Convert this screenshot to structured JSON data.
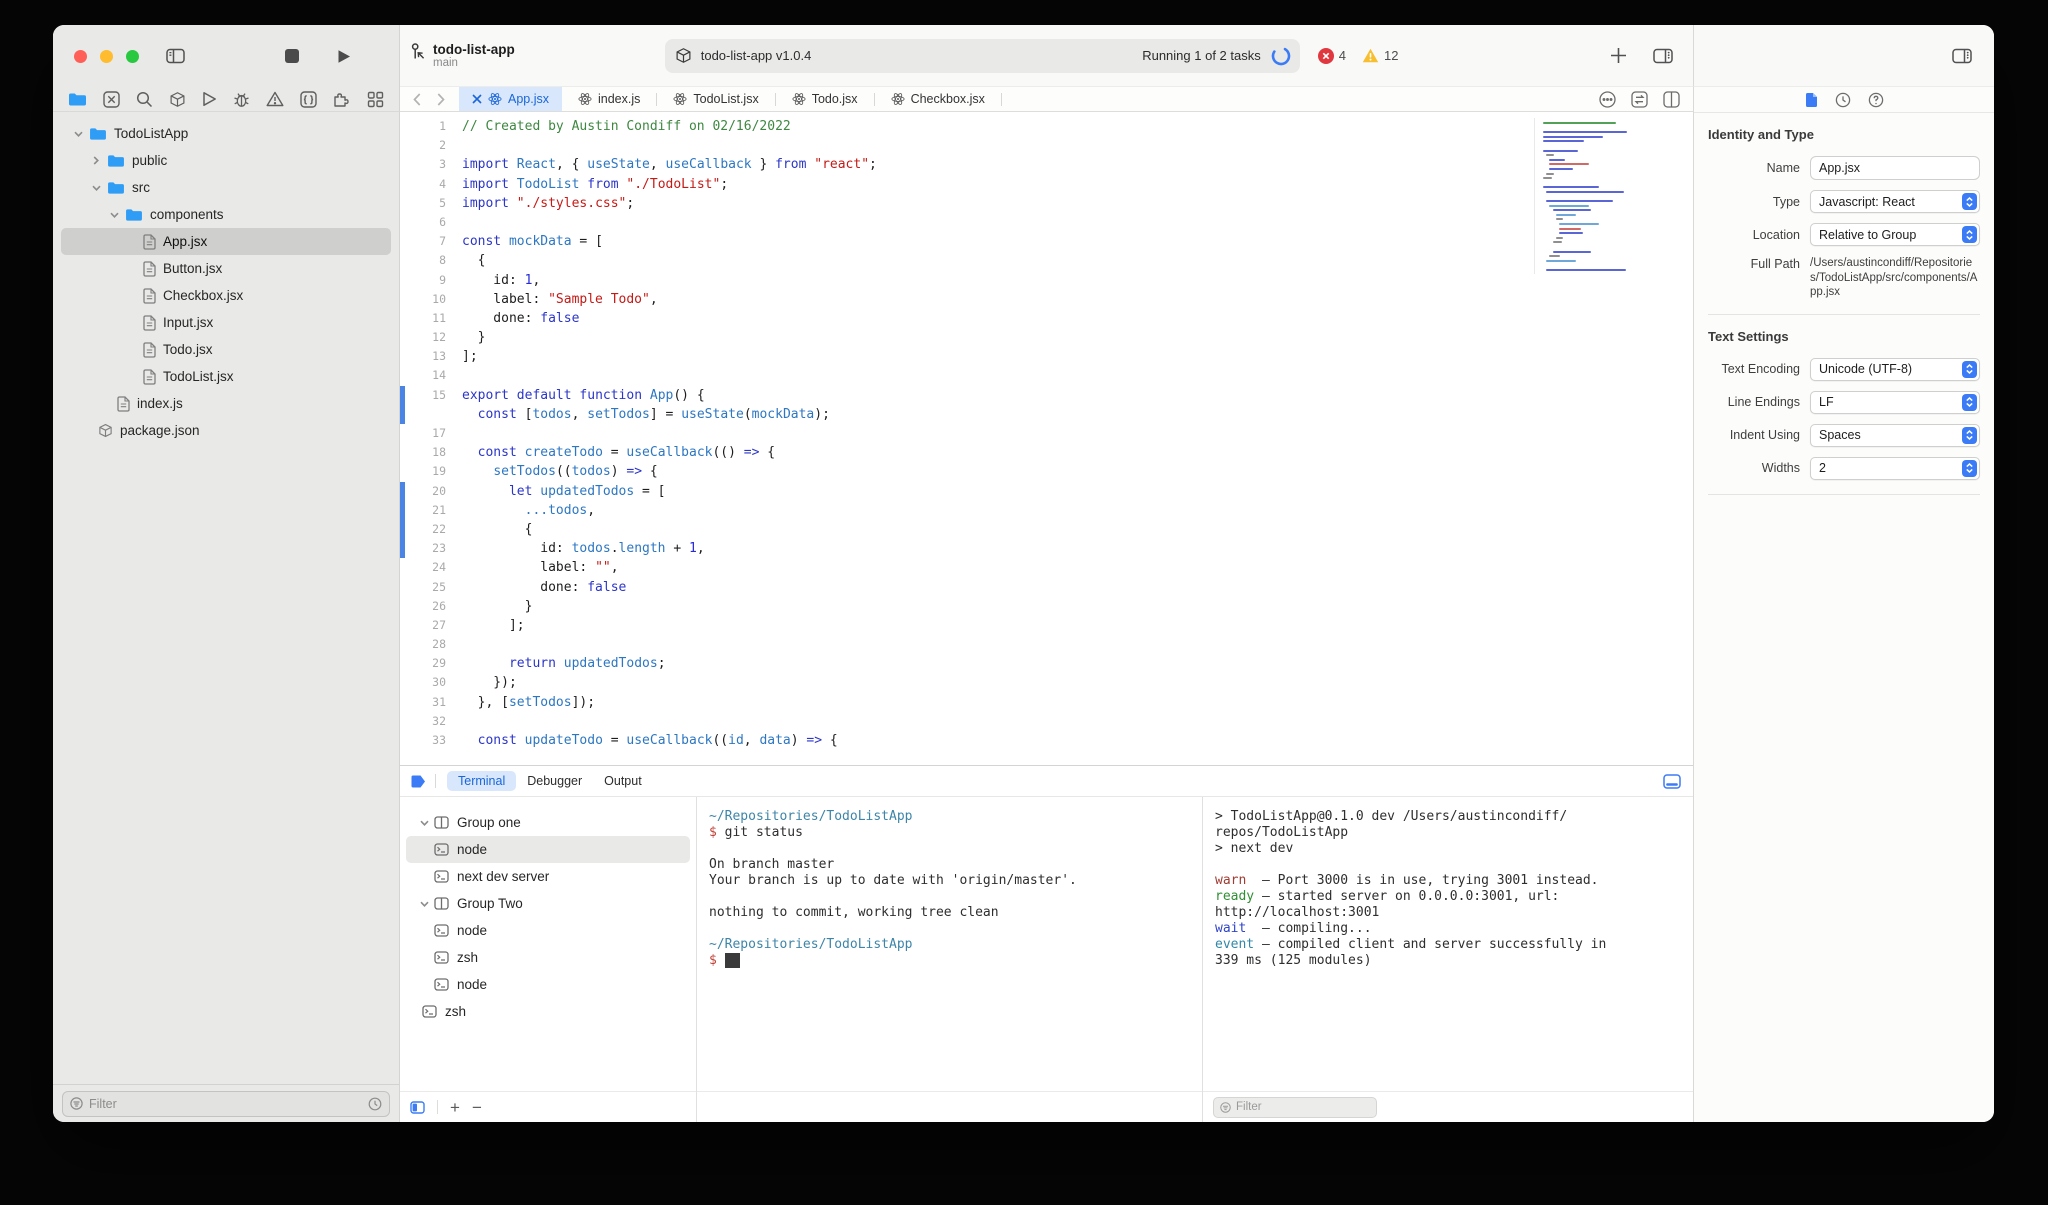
{
  "colors": {
    "accent": "#3b7cf6",
    "error": "#e0383e",
    "warning": "#f7bf2f",
    "tab_active_bg": "#d8e7fc",
    "tab_active_fg": "#1a66d8"
  },
  "window": {
    "project": "todo-list-app",
    "branch": "main"
  },
  "toolbar": {
    "scheme": "todo-list-app v1.0.4",
    "status": "Running 1 of 2 tasks",
    "error_count": "4",
    "warning_count": "12"
  },
  "editor": {
    "tabs": [
      "App.jsx",
      "index.js",
      "TodoList.jsx",
      "Todo.jsx",
      "Checkbox.jsx"
    ],
    "code": {
      "lines": [
        {
          "n": "1",
          "t": [
            [
              "c",
              "// Created by Austin Condiff on 02/16/2022"
            ]
          ]
        },
        {
          "n": "2",
          "t": []
        },
        {
          "n": "3",
          "t": [
            [
              "k",
              "import"
            ],
            [
              "p",
              " "
            ],
            [
              "id",
              "React"
            ],
            [
              "p",
              ", { "
            ],
            [
              "id",
              "useState"
            ],
            [
              "p",
              ", "
            ],
            [
              "id",
              "useCallback"
            ],
            [
              "p",
              " } "
            ],
            [
              "k",
              "from"
            ],
            [
              "p",
              " "
            ],
            [
              "s",
              "\"react\""
            ],
            [
              "p",
              ";"
            ]
          ]
        },
        {
          "n": "4",
          "t": [
            [
              "k",
              "import"
            ],
            [
              "p",
              " "
            ],
            [
              "id",
              "TodoList"
            ],
            [
              "p",
              " "
            ],
            [
              "k",
              "from"
            ],
            [
              "p",
              " "
            ],
            [
              "s",
              "\"./TodoList\""
            ],
            [
              "p",
              ";"
            ]
          ]
        },
        {
          "n": "5",
          "t": [
            [
              "k",
              "import"
            ],
            [
              "p",
              " "
            ],
            [
              "s",
              "\"./styles.css\""
            ],
            [
              "p",
              ";"
            ]
          ]
        },
        {
          "n": "6",
          "t": []
        },
        {
          "n": "7",
          "t": [
            [
              "k",
              "const"
            ],
            [
              "p",
              " "
            ],
            [
              "id",
              "mockData"
            ],
            [
              "p",
              " = ["
            ]
          ]
        },
        {
          "n": "8",
          "t": [
            [
              "p",
              "  {"
            ]
          ]
        },
        {
          "n": "9",
          "t": [
            [
              "p",
              "    id: "
            ],
            [
              "num",
              "1"
            ],
            [
              "p",
              ","
            ]
          ]
        },
        {
          "n": "10",
          "t": [
            [
              "p",
              "    label: "
            ],
            [
              "s",
              "\"Sample Todo\""
            ],
            [
              "p",
              ","
            ]
          ]
        },
        {
          "n": "11",
          "t": [
            [
              "p",
              "    done: "
            ],
            [
              "k",
              "false"
            ]
          ]
        },
        {
          "n": "12",
          "t": [
            [
              "p",
              "  }"
            ]
          ]
        },
        {
          "n": "13",
          "t": [
            [
              "p",
              "];"
            ]
          ]
        },
        {
          "n": "14",
          "t": []
        },
        {
          "n": "15",
          "m": 1,
          "t": [
            [
              "k",
              "export"
            ],
            [
              "p",
              " "
            ],
            [
              "k",
              "default"
            ],
            [
              "p",
              " "
            ],
            [
              "k",
              "function"
            ],
            [
              "p",
              " "
            ],
            [
              "id",
              "App"
            ],
            [
              "p",
              "() {"
            ]
          ]
        },
        {
          "n": "",
          "m": 1,
          "t": [
            [
              "p",
              "  "
            ],
            [
              "k",
              "const"
            ],
            [
              "p",
              " ["
            ],
            [
              "id",
              "todos"
            ],
            [
              "p",
              ", "
            ],
            [
              "id",
              "setTodos"
            ],
            [
              "p",
              "] = "
            ],
            [
              "id",
              "useState"
            ],
            [
              "p",
              "("
            ],
            [
              "id",
              "mockData"
            ],
            [
              "p",
              ");"
            ]
          ]
        },
        {
          "n": "17",
          "t": []
        },
        {
          "n": "18",
          "t": [
            [
              "p",
              "  "
            ],
            [
              "k",
              "const"
            ],
            [
              "p",
              " "
            ],
            [
              "id",
              "createTodo"
            ],
            [
              "p",
              " = "
            ],
            [
              "id",
              "useCallback"
            ],
            [
              "p",
              "(() "
            ],
            [
              "k",
              "=>"
            ],
            [
              "p",
              " {"
            ]
          ]
        },
        {
          "n": "19",
          "t": [
            [
              "p",
              "    "
            ],
            [
              "id",
              "setTodos"
            ],
            [
              "p",
              "(("
            ],
            [
              "id",
              "todos"
            ],
            [
              "p",
              ") "
            ],
            [
              "k",
              "=>"
            ],
            [
              "p",
              " {"
            ]
          ]
        },
        {
          "n": "20",
          "m": 1,
          "t": [
            [
              "p",
              "      "
            ],
            [
              "k",
              "let"
            ],
            [
              "p",
              " "
            ],
            [
              "id",
              "updatedTodos"
            ],
            [
              "p",
              " = ["
            ]
          ]
        },
        {
          "n": "21",
          "m": 1,
          "t": [
            [
              "p",
              "        "
            ],
            [
              "id",
              "...todos"
            ],
            [
              "p",
              ","
            ]
          ]
        },
        {
          "n": "22",
          "m": 1,
          "t": [
            [
              "p",
              "        {"
            ]
          ]
        },
        {
          "n": "23",
          "m": 1,
          "t": [
            [
              "p",
              "          id: "
            ],
            [
              "id",
              "todos"
            ],
            [
              "p",
              "."
            ],
            [
              "id",
              "length"
            ],
            [
              "p",
              " + "
            ],
            [
              "num",
              "1"
            ],
            [
              "p",
              ","
            ]
          ]
        },
        {
          "n": "24",
          "t": [
            [
              "p",
              "          label: "
            ],
            [
              "s",
              "\"\""
            ],
            [
              "p",
              ","
            ]
          ]
        },
        {
          "n": "25",
          "t": [
            [
              "p",
              "          done: "
            ],
            [
              "k",
              "false"
            ]
          ]
        },
        {
          "n": "26",
          "t": [
            [
              "p",
              "        }"
            ]
          ]
        },
        {
          "n": "27",
          "t": [
            [
              "p",
              "      ];"
            ]
          ]
        },
        {
          "n": "28",
          "t": []
        },
        {
          "n": "29",
          "t": [
            [
              "p",
              "      "
            ],
            [
              "k",
              "return"
            ],
            [
              "p",
              " "
            ],
            [
              "id",
              "updatedTodos"
            ],
            [
              "p",
              ";"
            ]
          ]
        },
        {
          "n": "30",
          "t": [
            [
              "p",
              "    });"
            ]
          ]
        },
        {
          "n": "31",
          "t": [
            [
              "p",
              "  }, ["
            ],
            [
              "id",
              "setTodos"
            ],
            [
              "p",
              "]);"
            ]
          ]
        },
        {
          "n": "32",
          "t": []
        },
        {
          "n": "33",
          "t": [
            [
              "p",
              "  "
            ],
            [
              "k",
              "const"
            ],
            [
              "p",
              " "
            ],
            [
              "id",
              "updateTodo"
            ],
            [
              "p",
              " = "
            ],
            [
              "id",
              "useCallback"
            ],
            [
              "p",
              "(("
            ],
            [
              "id",
              "id"
            ],
            [
              "p",
              ", "
            ],
            [
              "id",
              "data"
            ],
            [
              "p",
              ") "
            ],
            [
              "k",
              "=>"
            ],
            [
              "p",
              " {"
            ]
          ]
        }
      ]
    }
  },
  "sidebar": {
    "filter_placeholder": "Filter",
    "items": {
      "project": "TodoListApp",
      "public": "public",
      "src": "src",
      "components": "components",
      "files": [
        "App.jsx",
        "Button.jsx",
        "Checkbox.jsx",
        "Input.jsx",
        "Todo.jsx",
        "TodoList.jsx"
      ],
      "index": "index.js",
      "pkg": "package.json"
    }
  },
  "terminal": {
    "tabs": [
      "Terminal",
      "Debugger",
      "Output"
    ],
    "filter_placeholder": "Filter",
    "sessions": {
      "g1": "Group one",
      "n1": "node",
      "n2": "next dev server",
      "g2": "Group Two",
      "n3": "node",
      "z1": "zsh",
      "n4": "node",
      "z2": "zsh"
    },
    "git_pane": [
      [
        [
          "path",
          "~/Repositories/TodoListApp"
        ]
      ],
      [
        [
          "prompt",
          "$"
        ],
        [
          "pl",
          " git status"
        ]
      ],
      [],
      [
        [
          "pl",
          "On branch master"
        ]
      ],
      [
        [
          "pl",
          "Your branch is up to date with 'origin/master'."
        ]
      ],
      [],
      [
        [
          "pl",
          "nothing to commit, working tree clean"
        ]
      ],
      [],
      [
        [
          "path",
          "~/Repositories/TodoListApp"
        ]
      ],
      [
        [
          "prompt",
          "$"
        ],
        [
          "pl",
          " "
        ],
        [
          "cursor",
          "  "
        ]
      ]
    ],
    "dev_pane": [
      [
        [
          "pl",
          "> TodoListApp@0.1.0 dev /Users/austincondiff/"
        ]
      ],
      [
        [
          "pl",
          "repos/TodoListApp"
        ]
      ],
      [
        [
          "pl",
          "> next dev"
        ]
      ],
      [],
      [
        [
          "warn",
          "warn"
        ],
        [
          "pl",
          "  – Port 3000 is in use, trying 3001 instead."
        ]
      ],
      [
        [
          "ready",
          "ready"
        ],
        [
          "pl",
          " – started server on 0.0.0.0:3001, url:"
        ]
      ],
      [
        [
          "pl",
          "http://localhost:3001"
        ]
      ],
      [
        [
          "wait",
          "wait"
        ],
        [
          "pl",
          "  – compiling..."
        ]
      ],
      [
        [
          "event",
          "event"
        ],
        [
          "pl",
          " – compiled client and server successfully in"
        ]
      ],
      [
        [
          "pl",
          "339 ms (125 modules)"
        ]
      ]
    ]
  },
  "inspector": {
    "identity_heading": "Identity and Type",
    "name_label": "Name",
    "name_value": "App.jsx",
    "type_label": "Type",
    "type_value": "Javascript: React",
    "location_label": "Location",
    "location_value": "Relative to Group",
    "fullpath_label": "Full Path",
    "fullpath_value": "/Users/austincondiff/Repositories/TodoListApp/src/components/App.jsx",
    "text_heading": "Text Settings",
    "encoding_label": "Text Encoding",
    "encoding_value": "Unicode (UTF-8)",
    "lineendings_label": "Line Endings",
    "lineendings_value": "LF",
    "indent_label": "Indent Using",
    "indent_value": "Spaces",
    "widths_label": "Widths",
    "widths_value": "2"
  }
}
